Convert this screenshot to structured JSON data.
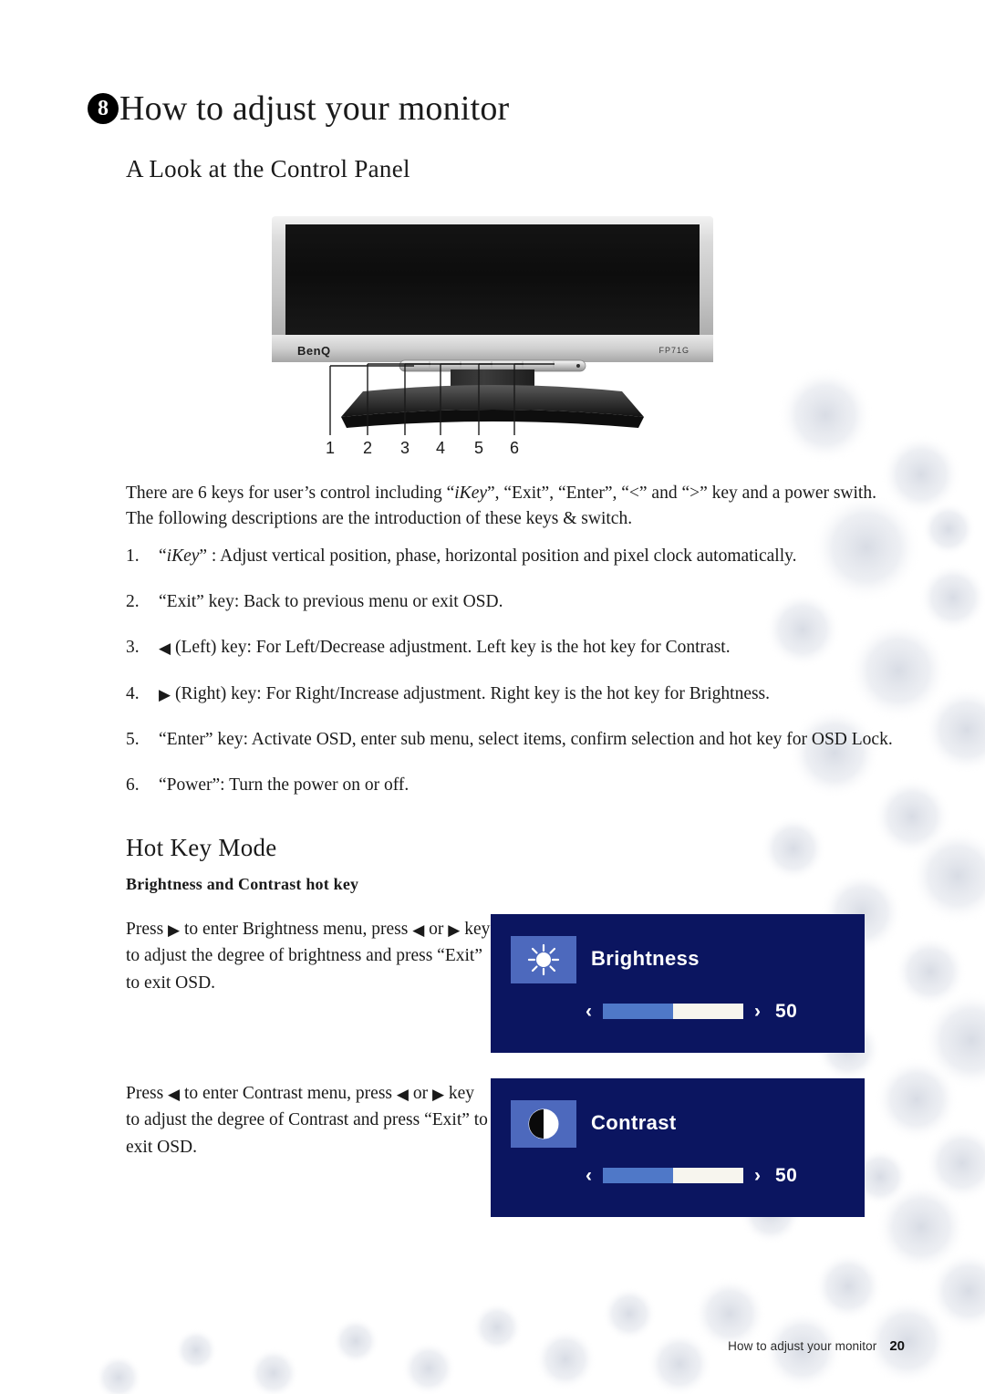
{
  "chapter": {
    "badge": "8",
    "title": "How to adjust your monitor"
  },
  "sections": {
    "control_panel": {
      "heading": "A Look at the Control Panel"
    },
    "hot_key_mode": {
      "heading": "Hot Key Mode",
      "sub_heading": "Brightness and Contrast hot key"
    }
  },
  "figure": {
    "brand_logo": "BenQ",
    "model_label": "FP71G",
    "callouts": [
      "1",
      "2",
      "3",
      "4",
      "5",
      "6"
    ]
  },
  "intro": {
    "line1_a": "There are 6 keys for user’s control including “",
    "line1_ikey": "iKey",
    "line1_b": "”, “Exit”, “Enter”, “<” and “>” key and a power swith. The following descriptions are the introduction of these keys & switch."
  },
  "key_list": [
    {
      "prefix_quote_open": "“",
      "ikey": "iKey",
      "text": "” : Adjust vertical position, phase, horizontal position and pixel clock automatically.",
      "glyph": ""
    },
    {
      "prefix_quote_open": "",
      "ikey": "",
      "text": "“Exit” key: Back to previous menu or exit OSD.",
      "glyph": ""
    },
    {
      "prefix_quote_open": "",
      "ikey": "",
      "text": "(Left) key: For Left/Decrease adjustment. Left key is the hot key for Contrast.",
      "glyph": "◀"
    },
    {
      "prefix_quote_open": "",
      "ikey": "",
      "text": "(Right) key: For Right/Increase adjustment. Right key is the hot key for Brightness.",
      "glyph": "▶"
    },
    {
      "prefix_quote_open": "",
      "ikey": "",
      "text": "“Enter” key: Activate OSD, enter sub menu, select items, confirm selection and hot key for OSD Lock.",
      "glyph": ""
    },
    {
      "prefix_quote_open": "",
      "ikey": "",
      "text": "“Power”: Turn the power on or off.",
      "glyph": ""
    }
  ],
  "hotkeys": [
    {
      "desc_pre": "Press",
      "desc_glyph1": "▶",
      "desc_mid": "to enter Brightness menu, press",
      "desc_glyph2": "◀",
      "desc_or": "or",
      "desc_glyph3": "▶",
      "desc_post": "key to adjust the degree of brightness and press “Exit” to exit OSD.",
      "osd": {
        "label": "Brightness",
        "icon": "sun-icon",
        "value": "50",
        "fill_percent": 50,
        "left_chevron": "‹",
        "right_chevron": "›"
      }
    },
    {
      "desc_pre": "Press",
      "desc_glyph1": "◀",
      "desc_mid": "to enter Contrast menu, press",
      "desc_glyph2": "◀",
      "desc_or": "or",
      "desc_glyph3": "▶",
      "desc_post": "key to adjust the degree of Contrast and press “Exit” to exit OSD.",
      "osd": {
        "label": "Contrast",
        "icon": "contrast-half-circle-icon",
        "value": "50",
        "fill_percent": 50,
        "left_chevron": "‹",
        "right_chevron": "›"
      }
    }
  ],
  "footer": {
    "label": "How to adjust your monitor",
    "page_number": "20"
  },
  "colors": {
    "osd_background": "#0b1560",
    "osd_icon_tile": "#4d69bd",
    "osd_slider_fill": "#4f78c8",
    "osd_slider_track": "#f7f5ee",
    "badge": "#000000"
  }
}
